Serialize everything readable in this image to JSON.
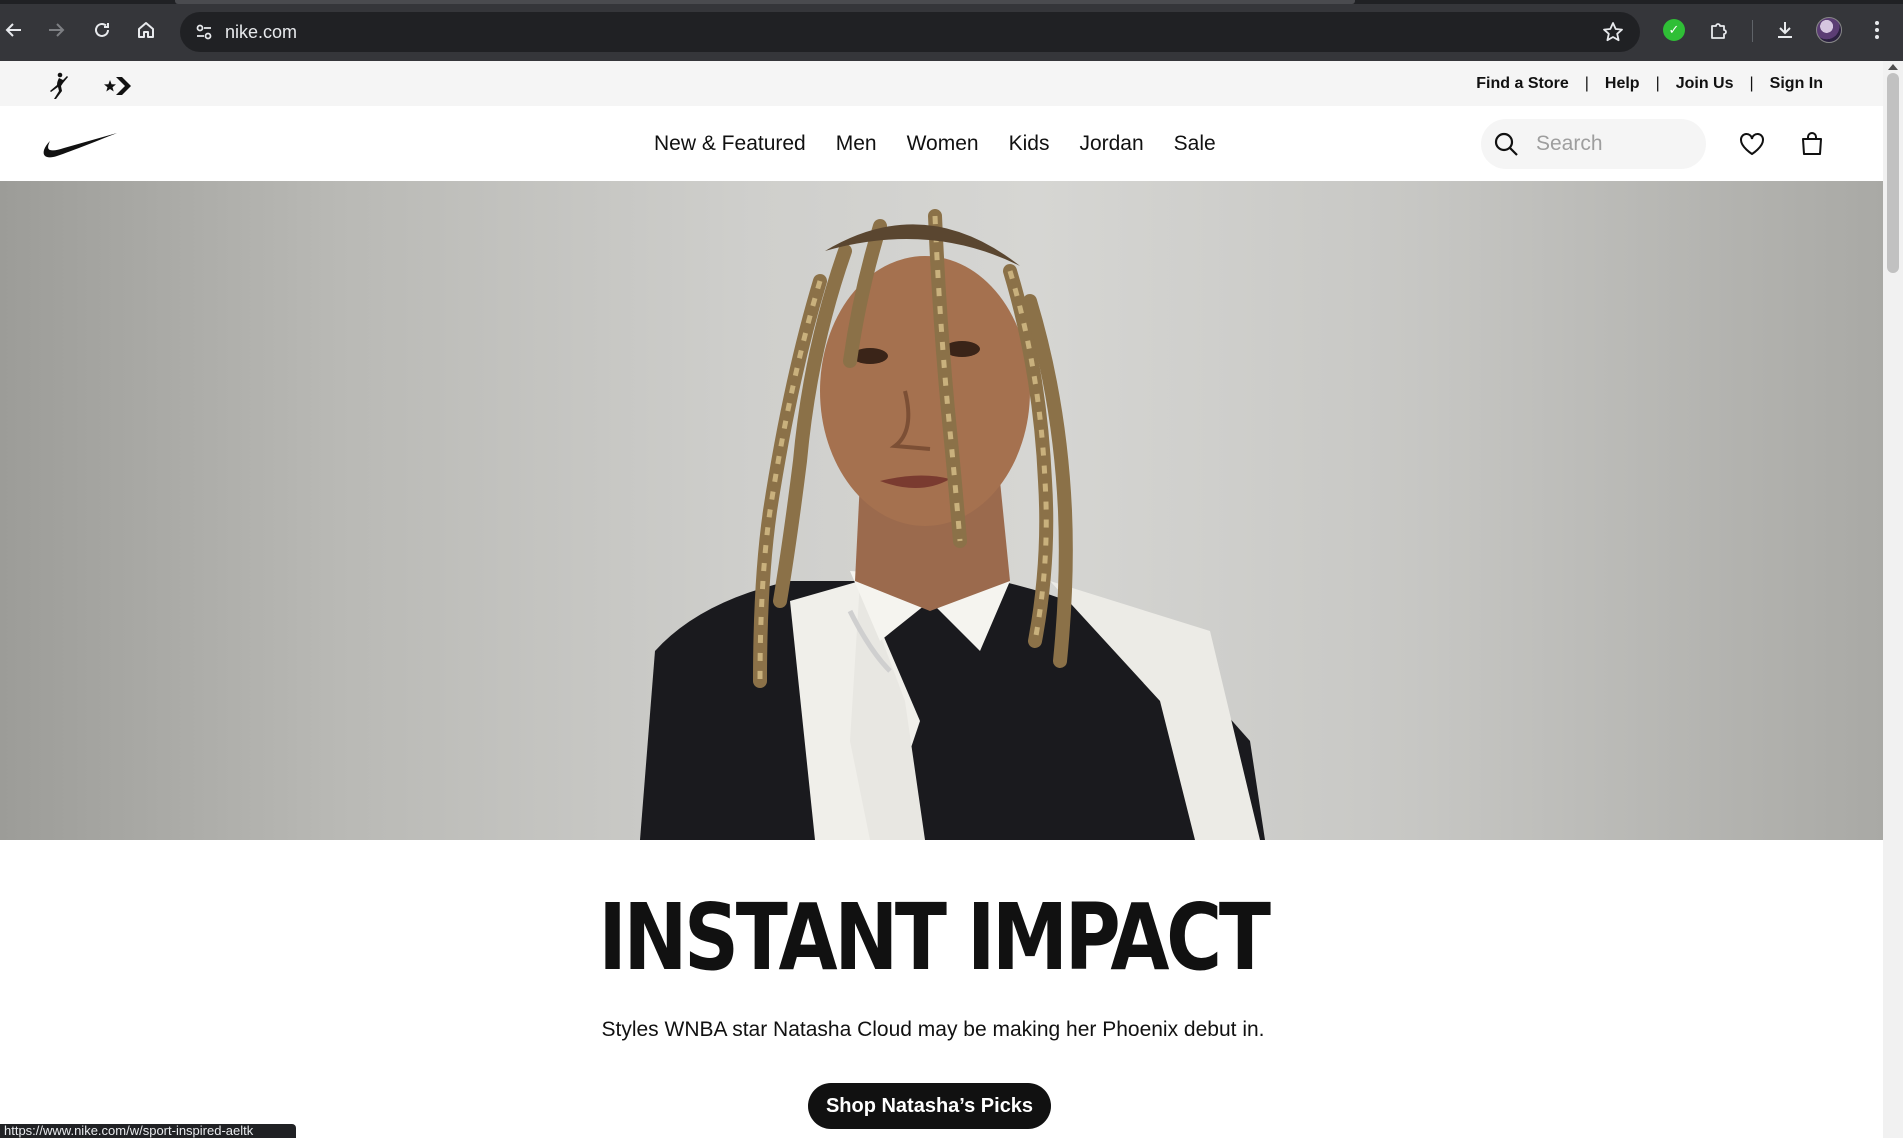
{
  "browser": {
    "url": "nike.com",
    "status_url": "https://www.nike.com/w/sport-inspired-aeltk"
  },
  "utility": {
    "links": [
      "Find a Store",
      "Help",
      "Join Us",
      "Sign In"
    ],
    "separator": "|"
  },
  "nav": {
    "items": [
      "New & Featured",
      "Men",
      "Women",
      "Kids",
      "Jordan",
      "Sale"
    ],
    "search_placeholder": "Search"
  },
  "hero": {
    "headline": "INSTANT IMPACT",
    "subline": "Styles WNBA star Natasha Cloud may be making her Phoenix debut in.",
    "cta_label": "Shop Natasha’s Picks"
  },
  "colors": {
    "chrome": "#35363a",
    "omnibox": "#202124",
    "utility_bg": "#f5f5f5",
    "text": "#111111",
    "cta_bg": "#111111"
  }
}
